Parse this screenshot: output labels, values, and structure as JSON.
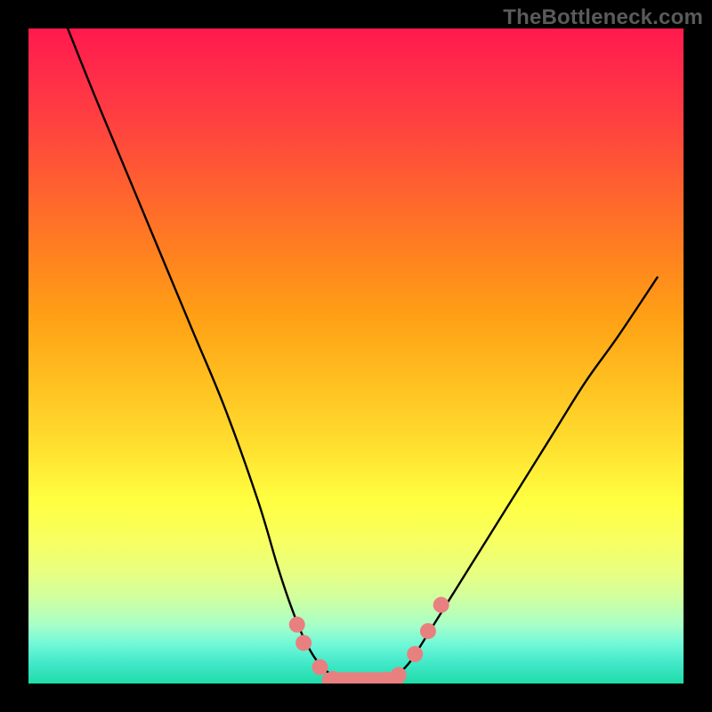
{
  "watermark": "TheBottleneck.com",
  "chart_data": {
    "type": "line",
    "title": "",
    "xlabel": "",
    "ylabel": "",
    "xlim": [
      0,
      100
    ],
    "ylim": [
      0,
      100
    ],
    "grid": false,
    "legend": false,
    "series": [
      {
        "name": "curve",
        "x": [
          6,
          10,
          15,
          20,
          25,
          30,
          35,
          38,
          40,
          42,
          44,
          46,
          48,
          50,
          52,
          54,
          56,
          58,
          60,
          65,
          70,
          75,
          80,
          85,
          90,
          96
        ],
        "y": [
          100,
          90,
          78,
          66,
          54,
          42,
          28,
          18,
          12,
          7,
          3.5,
          1.5,
          0.7,
          0.4,
          0.4,
          0.6,
          1.2,
          3,
          6,
          14,
          22,
          30,
          38,
          46,
          53,
          62
        ]
      }
    ],
    "markers": [
      {
        "x": 41.0,
        "y": 9.0
      },
      {
        "x": 42.0,
        "y": 6.2
      },
      {
        "x": 44.5,
        "y": 2.5
      },
      {
        "x": 46.5,
        "y": 0.7
      },
      {
        "x": 48.5,
        "y": 0.5
      },
      {
        "x": 50.5,
        "y": 0.5
      },
      {
        "x": 52.5,
        "y": 0.5
      },
      {
        "x": 54.5,
        "y": 0.6
      },
      {
        "x": 56.5,
        "y": 1.3
      },
      {
        "x": 59.0,
        "y": 4.5
      },
      {
        "x": 61.0,
        "y": 8.0
      },
      {
        "x": 63.0,
        "y": 12.0
      }
    ],
    "pill": {
      "x0": 46.0,
      "x1": 56.0,
      "y": 0.5
    },
    "marker_color": "#e98080",
    "curve_color": "#000000",
    "curve_width": 2.4
  }
}
